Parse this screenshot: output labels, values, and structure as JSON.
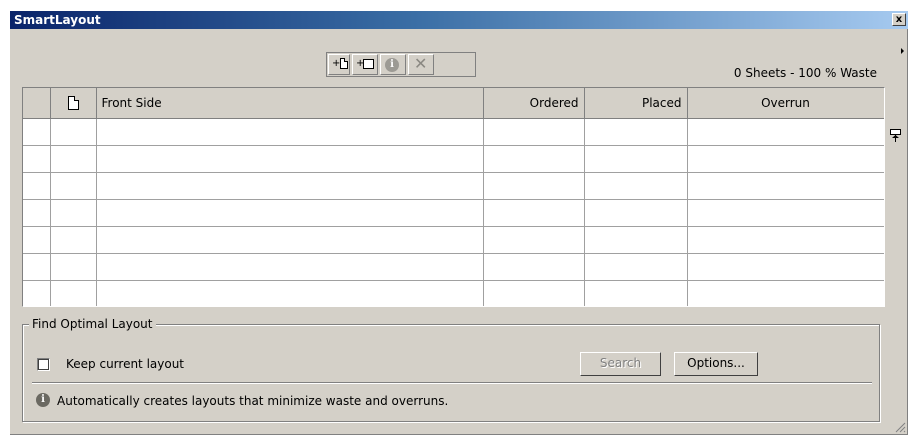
{
  "window": {
    "title": "SmartLayout",
    "close_label": "x"
  },
  "toolbar": {
    "add_page_icon": "add-page-icon",
    "add_sheet_icon": "add-sheet-icon",
    "info_icon": "info-icon",
    "delete_icon": "delete-icon",
    "plus_glyph": "+",
    "info_glyph": "i",
    "delete_glyph": "✕"
  },
  "status": {
    "sheets_summary": "0 Sheets - 100 % Waste"
  },
  "table": {
    "columns": [
      "",
      "",
      "Front Side",
      "Ordered",
      "Placed",
      "Overrun"
    ],
    "row_count": 7
  },
  "find_optimal": {
    "group_label": "Find Optimal Layout",
    "keep_layout_label": "Keep current layout",
    "keep_layout_checked": false,
    "search_label": "Search",
    "options_label": "Options...",
    "hint_text": "Automatically creates layouts that minimize waste and overruns.",
    "hint_glyph": "i"
  }
}
